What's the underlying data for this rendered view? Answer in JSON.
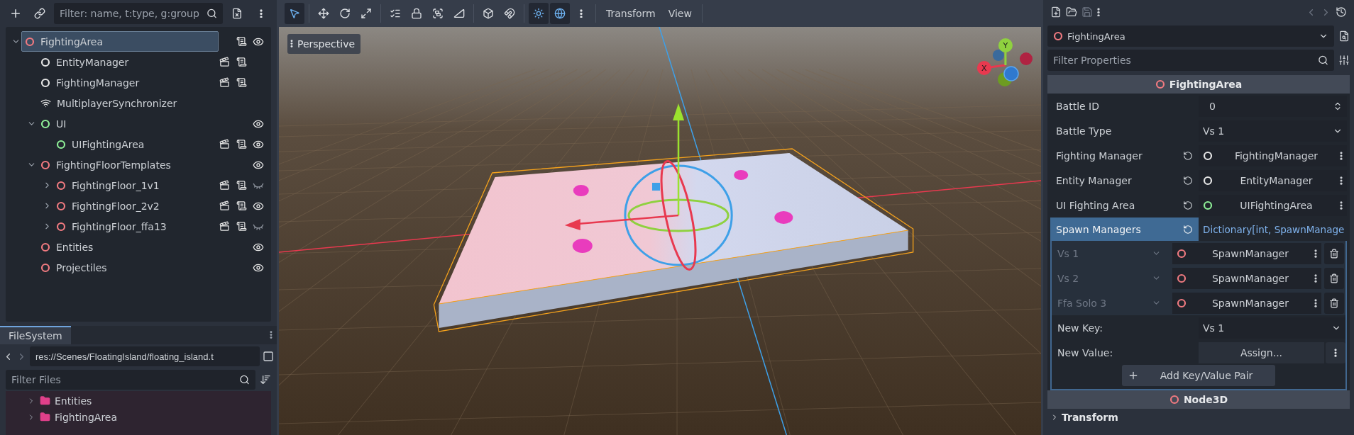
{
  "scene_dock": {
    "filter_placeholder": "Filter: name, t:type, g:group",
    "tree": [
      {
        "name": "FightingArea",
        "kind": "node",
        "color": "#f07a80",
        "selected": true,
        "expanded": true,
        "has_scene": false,
        "has_script": true,
        "visible": true,
        "children": [
          {
            "name": "EntityManager",
            "kind": "node",
            "color": "#e6e6e6",
            "selected": false,
            "has_scene": true,
            "has_script": true
          },
          {
            "name": "FightingManager",
            "kind": "node",
            "color": "#e6e6e6",
            "selected": false,
            "has_scene": true,
            "has_script": true
          },
          {
            "name": "MultiplayerSynchronizer",
            "kind": "sync",
            "selected": false,
            "has_scene": false,
            "has_script": false
          },
          {
            "name": "UI",
            "kind": "node",
            "color": "#8eef97",
            "selected": false,
            "expanded": true,
            "has_scene": false,
            "has_script": false,
            "visible": true,
            "children": [
              {
                "name": "UIFightingArea",
                "kind": "node",
                "color": "#8eef97",
                "selected": false,
                "has_scene": true,
                "has_script": true,
                "visible": true
              }
            ]
          },
          {
            "name": "FightingFloorTemplates",
            "kind": "node",
            "color": "#f07a80",
            "selected": false,
            "expanded": true,
            "has_scene": false,
            "has_script": false,
            "visible": true,
            "children": [
              {
                "name": "FightingFloor_1v1",
                "kind": "node",
                "color": "#f07a80",
                "selected": false,
                "expanded": false,
                "has_scene": true,
                "has_script": true,
                "visible": false
              },
              {
                "name": "FightingFloor_2v2",
                "kind": "node",
                "color": "#f07a80",
                "selected": false,
                "expanded": false,
                "has_scene": true,
                "has_script": true,
                "visible": true
              },
              {
                "name": "FightingFloor_ffa13",
                "kind": "node",
                "color": "#f07a80",
                "selected": false,
                "expanded": false,
                "has_scene": true,
                "has_script": true,
                "visible": false
              }
            ]
          },
          {
            "name": "Entities",
            "kind": "node",
            "color": "#f07a80",
            "selected": false,
            "has_scene": false,
            "has_script": false,
            "visible": true
          },
          {
            "name": "Projectiles",
            "kind": "node",
            "color": "#f07a80",
            "selected": false,
            "has_scene": false,
            "has_script": false,
            "visible": true
          }
        ]
      }
    ]
  },
  "filesystem": {
    "tab": "FileSystem",
    "path": "res://Scenes/FloatingIsland/floating_island.t",
    "filter_placeholder": "Filter Files",
    "items": [
      {
        "name": "Entities",
        "expanded": false
      },
      {
        "name": "FightingArea",
        "expanded": false
      }
    ]
  },
  "viewport_toolbar": {
    "tool_groups": [
      [
        {
          "kind": "select",
          "selected": true
        }
      ],
      [
        {
          "kind": "move",
          "selected": false
        },
        {
          "kind": "rotate",
          "selected": false
        },
        {
          "kind": "scale",
          "selected": false
        }
      ],
      [
        {
          "kind": "list",
          "selected": false
        },
        {
          "kind": "lock",
          "selected": false
        },
        {
          "kind": "group",
          "selected": false
        },
        {
          "kind": "ruler",
          "selected": false
        }
      ],
      [
        {
          "kind": "cube",
          "selected": false
        },
        {
          "kind": "snap",
          "selected": false
        }
      ],
      [
        {
          "kind": "sun",
          "selected": true
        },
        {
          "kind": "globe",
          "selected": true
        },
        {
          "kind": "more",
          "selected": false
        }
      ]
    ],
    "menus": [
      "Transform",
      "View"
    ]
  },
  "viewport": {
    "view_label": "Perspective",
    "gizmo": {
      "x_label": "X",
      "y_label": "Y"
    }
  },
  "inspector": {
    "node": {
      "name": "FightingArea",
      "color": "#f07a80"
    },
    "filter_placeholder": "Filter Properties",
    "sections": [
      {
        "title": "FightingArea",
        "color": "#f07a80",
        "properties": [
          {
            "kind": "number",
            "label": "Battle ID",
            "value": "0",
            "selected": false
          },
          {
            "kind": "enum",
            "label": "Battle Type",
            "value": "Vs 1",
            "selected": false
          },
          {
            "kind": "node",
            "label": "Fighting Manager",
            "value": "FightingManager",
            "color": "#e6e6e6",
            "selected": false
          },
          {
            "kind": "node",
            "label": "Entity Manager",
            "value": "EntityManager",
            "color": "#e6e6e6",
            "selected": false
          },
          {
            "kind": "node",
            "label": "UI Fighting Area",
            "value": "UIFightingArea",
            "color": "#8eef97",
            "selected": false
          },
          {
            "kind": "dictionary",
            "label": "Spawn Managers",
            "value": "Dictionary[int, SpawnManage",
            "selected": true,
            "entries": [
              {
                "key": "Vs 1",
                "value": "SpawnManager",
                "color": "#f07a80"
              },
              {
                "key": "Vs 2",
                "value": "SpawnManager",
                "color": "#f07a80"
              },
              {
                "key": "Ffa Solo 3",
                "value": "SpawnManager",
                "color": "#f07a80"
              }
            ],
            "new_key_label": "New Key:",
            "new_key": "Vs 1",
            "new_value_label": "New Value:",
            "new_value": "Assign...",
            "add_label": "Add Key/Value Pair"
          }
        ]
      },
      {
        "title": "Node3D",
        "color": "#f07a80",
        "groups": [
          {
            "label": "Transform",
            "expanded": false
          }
        ]
      }
    ]
  }
}
